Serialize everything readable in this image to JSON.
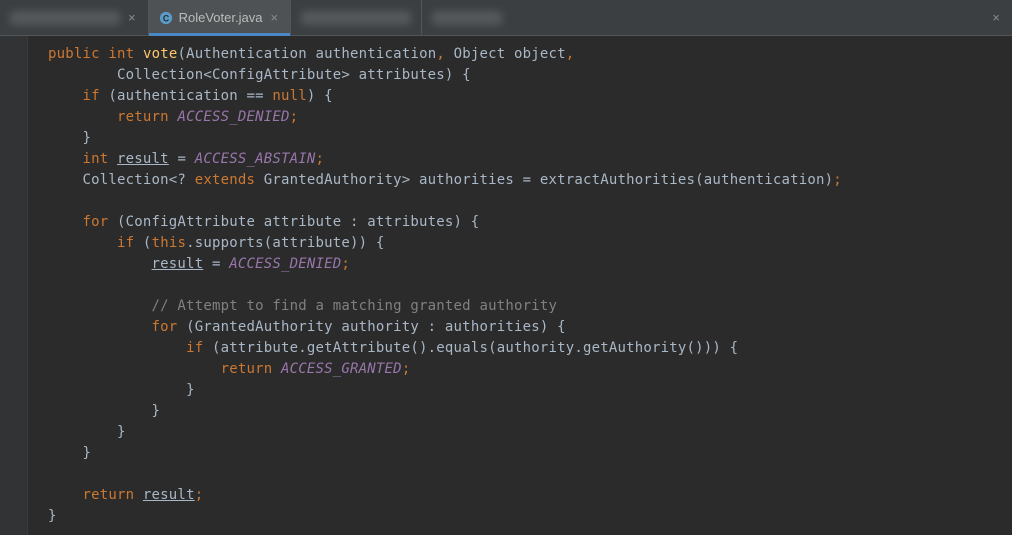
{
  "tabs": {
    "active": {
      "label": "RoleVoter.java"
    }
  },
  "code": {
    "kw_public": "public",
    "kw_int": "int",
    "kw_if": "if",
    "kw_return": "return",
    "kw_null": "null",
    "kw_for": "for",
    "kw_this": "this",
    "kw_extends": "extends",
    "method_vote": "vote",
    "sig_part1": "(Authentication authentication",
    "sig_sep": ", ",
    "sig_part2": "Object object",
    "sig_end": ",",
    "sig_line2": "Collection<ConfigAttribute> attributes) {",
    "if_cond": " (authentication == ",
    "if_cond_end": ") {",
    "access_denied": "ACCESS_DENIED",
    "semi": ";",
    "brace_close": "}",
    "int_decl": "int ",
    "result": "result",
    "eq": " = ",
    "access_abstain": "ACCESS_ABSTAIN",
    "coll_line_pre": "Collection<? ",
    "coll_line_post": " GrantedAuthority> authorities = extractAuthorities(authentication)",
    "for1": " (ConfigAttribute attribute : attributes) {",
    "if2_pre": " (",
    "if2_post": ".supports(attribute)) {",
    "comment": "// Attempt to find a matching granted authority",
    "for2": " (GrantedAuthority authority : authorities) {",
    "if3": " (attribute.getAttribute().equals(authority.getAuthority())) {",
    "access_granted": "ACCESS_GRANTED",
    "return_sp": "return "
  }
}
